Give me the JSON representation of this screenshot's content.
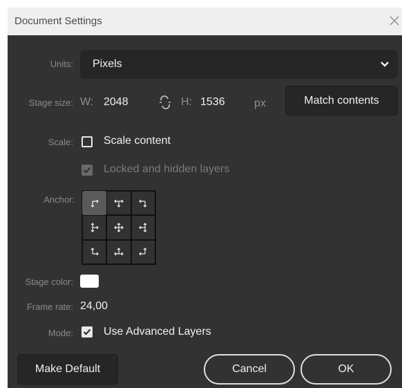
{
  "window": {
    "title": "Document Settings"
  },
  "units": {
    "label": "Units:",
    "value": "Pixels"
  },
  "stage_size": {
    "label": "Stage size:",
    "w_label": "W:",
    "w_value": "2048",
    "h_label": "H:",
    "h_value": "1536",
    "unit": "px",
    "match_button": "Match contents"
  },
  "scale": {
    "label": "Scale:",
    "scale_content": {
      "label": "Scale content",
      "checked": false
    },
    "locked_hidden": {
      "label": "Locked and hidden layers",
      "checked": true,
      "disabled": true
    }
  },
  "anchor": {
    "label": "Anchor:",
    "selected": "top-left"
  },
  "stage_color": {
    "label": "Stage color:",
    "value": "#ffffff"
  },
  "frame_rate": {
    "label": "Frame rate:",
    "value": "24,00"
  },
  "mode": {
    "label": "Mode:",
    "option": "Use Advanced Layers",
    "checked": true
  },
  "footer": {
    "make_default": "Make Default",
    "cancel": "Cancel",
    "ok": "OK"
  },
  "icons": [
    "close-icon",
    "chevron-down-icon",
    "link-broken-icon",
    "checkmark-icon",
    "anchor-arrows-icon"
  ]
}
